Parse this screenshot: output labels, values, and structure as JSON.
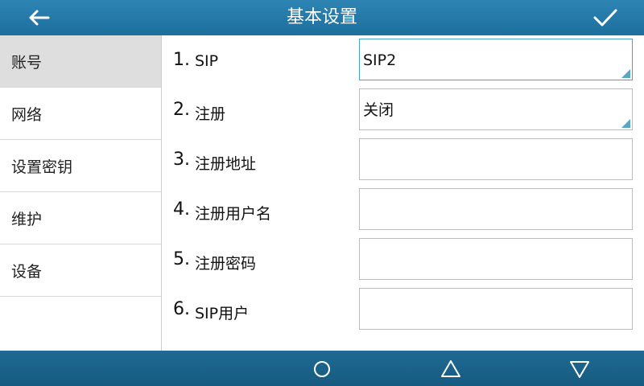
{
  "header": {
    "title": "基本设置",
    "back_icon": "back-arrow-icon",
    "confirm_icon": "checkmark-icon"
  },
  "sidebar": {
    "items": [
      {
        "label": "账号",
        "active": true
      },
      {
        "label": "网络",
        "active": false
      },
      {
        "label": "设置密钥",
        "active": false
      },
      {
        "label": "维护",
        "active": false
      },
      {
        "label": "设备",
        "active": false
      }
    ]
  },
  "form": {
    "rows": [
      {
        "num": "1.",
        "label": "SIP",
        "value": "SIP2",
        "type": "select"
      },
      {
        "num": "2.",
        "label": "注册",
        "value": "关闭",
        "type": "select"
      },
      {
        "num": "3.",
        "label": "注册地址",
        "value": "",
        "type": "text"
      },
      {
        "num": "4.",
        "label": "注册用户名",
        "value": "",
        "type": "text"
      },
      {
        "num": "5.",
        "label": "注册密码",
        "value": "",
        "type": "text"
      },
      {
        "num": "6.",
        "label": "SIP用户",
        "value": "",
        "type": "text"
      }
    ]
  },
  "softkeys": [
    "circle-icon",
    "triangle-up-icon",
    "triangle-down-icon"
  ],
  "colors": {
    "header": "#2479a8",
    "bottom_bar": "#1b6289",
    "active_sidebar": "#dedede",
    "dropdown_indicator": "#5aa7c4"
  }
}
